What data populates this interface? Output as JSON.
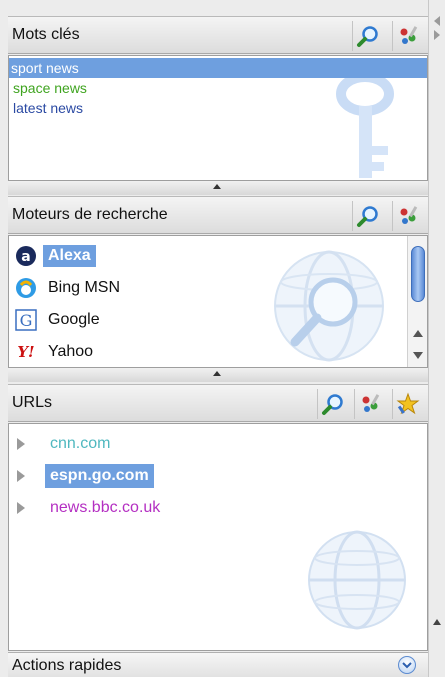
{
  "keywords": {
    "title": "Mots clés",
    "items": [
      {
        "label": "sport news",
        "color": "#ffffff",
        "selected": true
      },
      {
        "label": "space news",
        "color": "#3fa41f",
        "selected": false
      },
      {
        "label": "latest news",
        "color": "#2b4aa3",
        "selected": false
      }
    ],
    "icons": [
      "search-icon",
      "manage-icon",
      "key-icon"
    ]
  },
  "engines": {
    "title": "Moteurs de recherche",
    "items": [
      {
        "label": "Alexa",
        "icon": "alexa-icon",
        "selected": true
      },
      {
        "label": "Bing MSN",
        "icon": "bing-icon",
        "selected": false
      },
      {
        "label": "Google",
        "icon": "google-icon",
        "selected": false
      },
      {
        "label": "Yahoo",
        "icon": "yahoo-icon",
        "selected": false
      }
    ],
    "icons": [
      "search-icon",
      "manage-icon",
      "globe-magnifier-icon"
    ]
  },
  "urls": {
    "title": "URLs",
    "items": [
      {
        "label": "cnn.com",
        "color": "#4fb8bf",
        "selected": false
      },
      {
        "label": "espn.go.com",
        "color": "#ffffff",
        "selected": true
      },
      {
        "label": "news.bbc.co.uk",
        "color": "#b42fc2",
        "selected": false
      }
    ],
    "icons": [
      "search-icon",
      "manage-icon",
      "favorite-icon",
      "globe-icon"
    ]
  },
  "quick_actions": {
    "title": "Actions rapides",
    "icon": "chevron-down-icon"
  },
  "colors": {
    "selection": "#6e9fdf",
    "accent": "#3f6fbb"
  }
}
